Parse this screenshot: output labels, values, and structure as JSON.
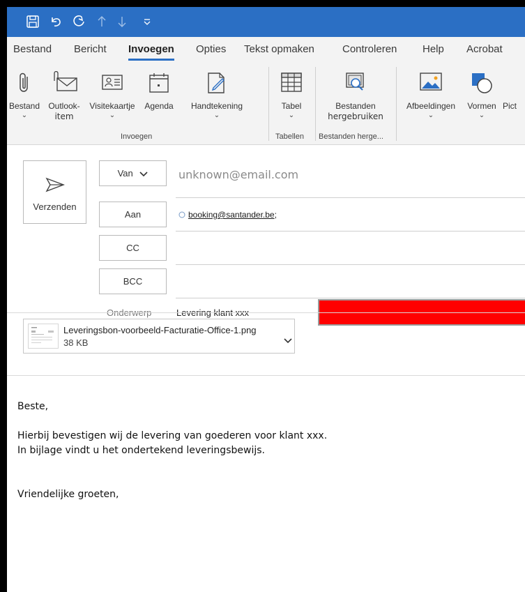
{
  "window": {
    "accent": "#2b6fc4",
    "redaction_color": "#ff0000"
  },
  "quick_access": [
    "save-icon",
    "undo-icon",
    "redo-icon",
    "up-arrow-icon",
    "down-arrow-icon",
    "customize-icon"
  ],
  "tabs": [
    {
      "label": "Bestand"
    },
    {
      "label": "Bericht"
    },
    {
      "label": "Invoegen",
      "active": true
    },
    {
      "label": "Opties"
    },
    {
      "label": "Tekst opmaken"
    },
    {
      "label": "Controleren"
    },
    {
      "label": "Help"
    },
    {
      "label": "Acrobat"
    }
  ],
  "ribbon": {
    "buttons": {
      "bestand": {
        "line1": "Bestand",
        "line2": "⌄"
      },
      "outlook_item": {
        "line1": "Outlook-",
        "line2": "item"
      },
      "visitekaartje": {
        "line1": "Visitekaartje",
        "line2": "⌄"
      },
      "agenda": {
        "line1": "Agenda"
      },
      "handtekening": {
        "line1": "Handtekening",
        "line2": "⌄"
      },
      "tabel": {
        "line1": "Tabel",
        "line2": "⌄"
      },
      "bestanden_hergebruiken": {
        "line1": "Bestanden",
        "line2": "hergebruiken"
      },
      "afbeeldingen": {
        "line1": "Afbeeldingen",
        "line2": "⌄"
      },
      "vormen": {
        "line1": "Vormen",
        "line2": "⌄"
      },
      "pict": {
        "line1": "Pict"
      }
    },
    "groups": {
      "invoegen": "Invoegen",
      "tabellen": "Tabellen",
      "bestanden": "Bestanden herge..."
    }
  },
  "compose": {
    "send_label": "Verzenden",
    "from_label": "Van",
    "from_value": "unknown@email.com",
    "to_label": "Aan",
    "to_value": "booking@santander.be",
    "to_suffix": ";",
    "cc_label": "CC",
    "bcc_label": "BCC",
    "subject_label": "Onderwerp",
    "subject_value": "Levering klant xxx"
  },
  "attachment": {
    "name": "Leveringsbon-voorbeeld-Facturatie-Office-1.png",
    "size": "38 KB"
  },
  "body": {
    "greeting": "Beste,",
    "line1": "Hierbij bevestigen wij de levering van goederen voor klant xxx.",
    "line2": "In bijlage vindt u het ondertekend leveringsbewijs.",
    "closing": "Vriendelijke groeten,"
  }
}
